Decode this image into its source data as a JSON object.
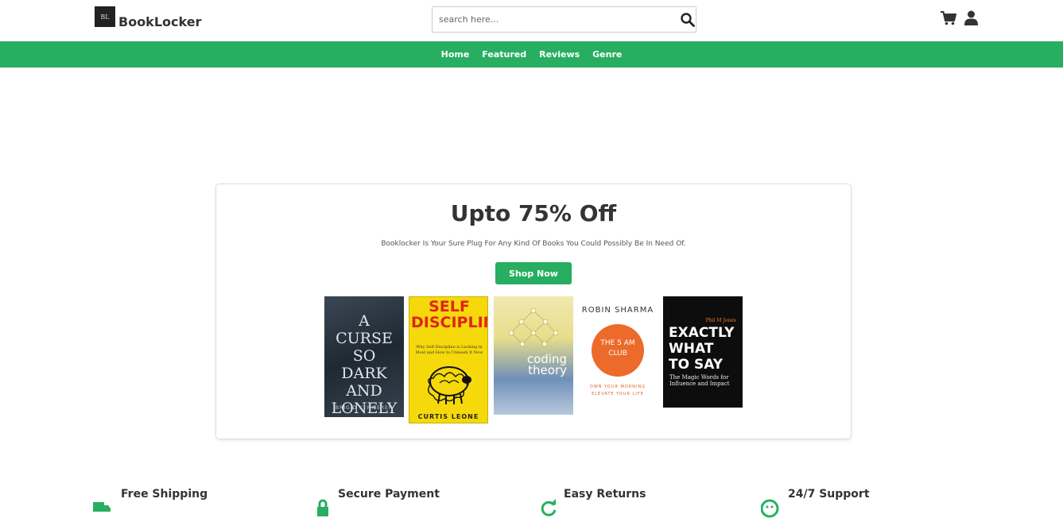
{
  "brand": {
    "name": "BookLocker",
    "logo_mark": "BL"
  },
  "search": {
    "placeholder": "search here..."
  },
  "icons": {
    "search": "search-icon",
    "cart": "cart-icon",
    "user": "user-icon"
  },
  "nav": {
    "items": [
      "Home",
      "Featured",
      "Reviews",
      "Genre"
    ]
  },
  "hero": {
    "title": "Upto 75% Off",
    "subtitle": "Booklocker Is Your Sure Plug For Any Kind Of Books You Could Possibly Be In Need Of.",
    "button": "Shop Now",
    "books": [
      {
        "title": "A CURSE SO DARK AND LONELY",
        "author": "BRIGID KEMMERER"
      },
      {
        "title": "SELF DISCIPLINE",
        "subtitle": "Why Self Discipline is Lacking in Most and How to Unleash It Now",
        "author": "CURTIS LEONE"
      },
      {
        "title": "coding theory"
      },
      {
        "title": "THE 5 AM CLUB",
        "author": "ROBIN SHARMA",
        "tagline": "OWN YOUR MORNING ELEVATE YOUR LIFE"
      },
      {
        "title": "EXACTLY WHAT TO SAY",
        "author": "Phil M Jones",
        "subtitle": "The Magic Words for Influence and Impact"
      }
    ]
  },
  "features": [
    {
      "label": "Free Shipping",
      "icon": "truck-icon"
    },
    {
      "label": "Secure Payment",
      "icon": "lock-icon"
    },
    {
      "label": "Easy Returns",
      "icon": "redo-icon"
    },
    {
      "label": "24/7 Support",
      "icon": "headset-icon"
    }
  ],
  "colors": {
    "accent": "#27ae60",
    "text": "#333333"
  }
}
